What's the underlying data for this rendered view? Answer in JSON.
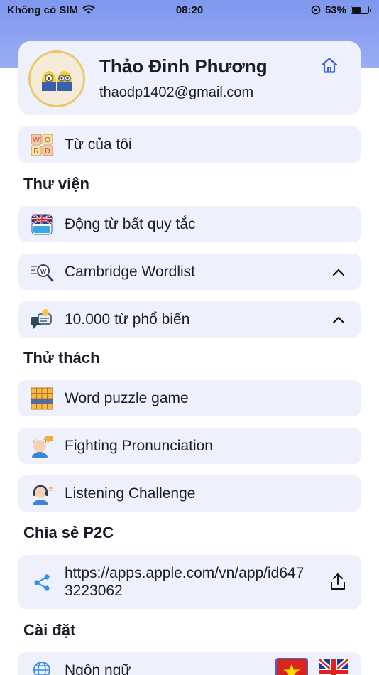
{
  "status_bar": {
    "carrier": "Không có SIM",
    "time": "08:20",
    "battery_percent": "53%",
    "battery_level": 0.53
  },
  "profile": {
    "name": "Thảo Đinh Phương",
    "email": "thaodp1402@gmail.com",
    "avatar_icon": "minions-avatar",
    "home_icon": "home-icon"
  },
  "my_words": {
    "label": "Từ của tôi",
    "icon": "word-blocks-icon"
  },
  "sections": {
    "library": "Thư viện",
    "challenge": "Thử thách",
    "share": "Chia sẻ P2C",
    "settings": "Cài đặt"
  },
  "library_items": [
    {
      "label": "Động từ bất quy tắc",
      "icon": "irregular-verbs-book-icon",
      "expandable": false
    },
    {
      "label": "Cambridge Wordlist",
      "icon": "word-search-icon",
      "expandable": true
    },
    {
      "label": "10.000 từ phổ biến",
      "icon": "chat-idea-icon",
      "expandable": true
    }
  ],
  "challenge_items": [
    {
      "label": "Word puzzle game",
      "icon": "puzzle-grid-icon"
    },
    {
      "label": "Fighting Pronunciation",
      "icon": "speaking-person-icon"
    },
    {
      "label": "Listening Challenge",
      "icon": "headphones-person-icon"
    }
  ],
  "share": {
    "url": "https://apps.apple.com/vn/app/id6473223062",
    "icon": "share-icon",
    "action_icon": "upload-icon"
  },
  "settings": {
    "language_label": "Ngôn ngữ",
    "icon": "globe-icon",
    "flags": [
      "vietnam-flag-icon",
      "uk-flag-icon"
    ],
    "selected_flag": "vietnam-flag-icon"
  },
  "colors": {
    "header_gradient_top": "#7f98ee",
    "card_bg": "#eef0fb",
    "accent_blue": "#3d63d8",
    "avatar_ring": "#e9c869"
  }
}
